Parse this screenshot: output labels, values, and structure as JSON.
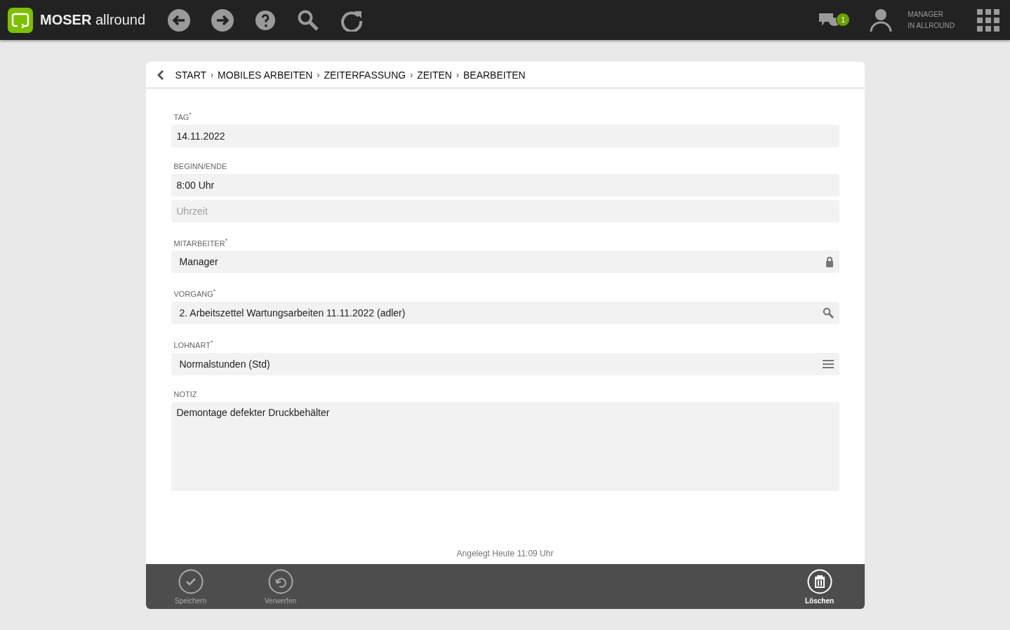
{
  "app": {
    "brand_bold": "MOSER",
    "brand_light": "allround",
    "messages_badge": "1",
    "user_line_1": "MANAGER",
    "user_line_2": "IN ALLROUND"
  },
  "breadcrumb_separator": "›",
  "breadcrumb": [
    "START",
    "MOBILES ARBEITEN",
    "ZEITERFASSUNG",
    "ZEITEN",
    "BEARBEITEN"
  ],
  "fields": [
    {
      "label": "TAG$^{*}$",
      "inputs": [
        {
          "kind": "line",
          "value": "14.11.2022"
        }
      ]
    },
    {
      "label": "BEGINN/ENDE",
      "inputs": [
        {
          "kind": "line",
          "value": "8:00 Uhr"
        },
        {
          "kind": "line",
          "placeholder": "Uhrzeit"
        }
      ]
    },
    {
      "label": "MITARBEITER$^{*}$",
      "kind": "locked",
      "inputs": [
        {
          "kind": "line",
          "value": "Manager"
        }
      ]
    },
    {
      "label": "VORGANG$^{*}$",
      "kind": "lookup",
      "inputs": [
        {
          "kind": "line",
          "value": "2. Arbeitszettel Wartungsarbeiten 11.11.2022 (adler)"
        }
      ]
    },
    {
      "label": "LOHNART$^{*}$",
      "kind": "choice",
      "inputs": [
        {
          "kind": "line",
          "value": "Normalstunden (Std)"
        }
      ]
    },
    {
      "label": "NOTIZ",
      "inputs": [
        {
          "kind": "area",
          "value": "Demontage defekter Druckbehälter"
        }
      ]
    }
  ],
  "created": "Angelegt Heute 11:09 Uhr",
  "actions": [
    {
      "kind": "save",
      "label": "Speichern",
      "disabled": true
    },
    {
      "kind": "discard",
      "label": "Verwerfen",
      "disabled": true
    },
    {
      "kind": "delete",
      "label": "Löschen",
      "disabled": false
    }
  ]
}
